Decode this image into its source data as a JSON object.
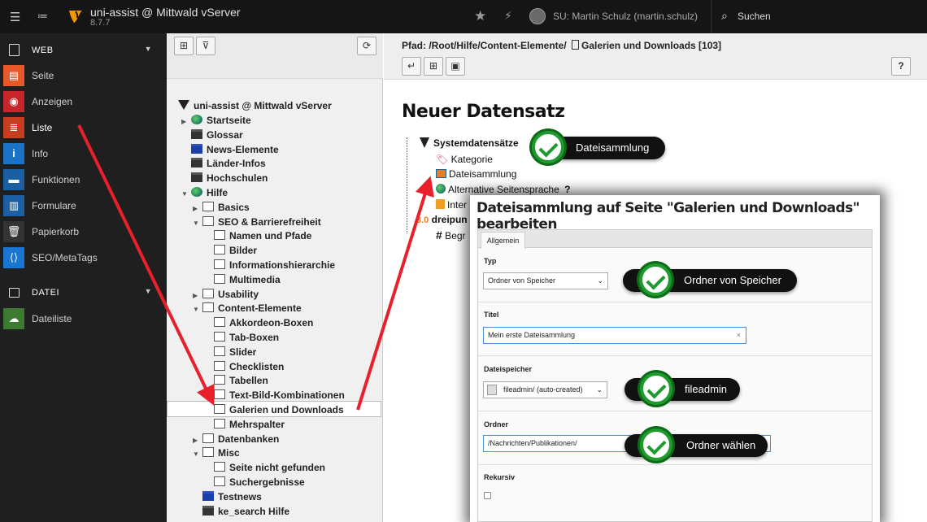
{
  "topbar": {
    "site_title": "uni-assist @ Mittwald vServer",
    "version": "8.7.7",
    "user": "SU: Martin Schulz (martin.schulz)",
    "search_label": "Suchen"
  },
  "sidebar": {
    "groups": [
      {
        "label": "WEB"
      },
      {
        "label": "DATEI"
      }
    ],
    "web_items": [
      {
        "label": "Seite",
        "color": "#e8582a"
      },
      {
        "label": "Anzeigen",
        "color": "#c6262b"
      },
      {
        "label": "Liste",
        "color": "#c43e1f"
      },
      {
        "label": "Info",
        "color": "#1a73c6"
      },
      {
        "label": "Funktionen",
        "color": "#1a5fa2"
      },
      {
        "label": "Formulare",
        "color": "#1d5fa3"
      },
      {
        "label": "Papierkorb",
        "color": "#333333"
      },
      {
        "label": "SEO/MetaTags",
        "color": "#1976d2"
      }
    ],
    "datei_items": [
      {
        "label": "Dateiliste",
        "color": "#3b7a2f"
      }
    ]
  },
  "tree": {
    "root": "uni-assist @ Mittwald vServer",
    "nodes": [
      "Startseite",
      "Glossar",
      "News-Elemente",
      "Länder-Infos",
      "Hochschulen",
      "Hilfe",
      "Basics",
      "SEO & Barrierefreiheit",
      "Namen und Pfade",
      "Bilder",
      "Informationshierarchie",
      "Multimedia",
      "Usability",
      "Content-Elemente",
      "Akkordeon-Boxen",
      "Tab-Boxen",
      "Slider",
      "Checklisten",
      "Tabellen",
      "Text-Bild-Kombinationen",
      "Galerien und Downloads",
      "Mehrspalter",
      "Datenbanken",
      "Misc",
      "Seite nicht gefunden",
      "Suchergebnisse",
      "Testnews",
      "ke_search Hilfe"
    ]
  },
  "doc": {
    "path_label": "Pfad: /Root/Hilfe/Content-Elemente/",
    "page_title": "Galerien und Downloads [103]",
    "help_label": "?",
    "heading": "Neuer Datensatz",
    "records": {
      "group": "Systemdatensätze",
      "items": [
        "Kategorie",
        "Dateisammlung",
        "Alternative Seitensprache",
        "Inter",
        "dreipun",
        "Begr"
      ],
      "question": "?"
    }
  },
  "dialog": {
    "title": "Dateisammlung auf Seite \"Galerien und Downloads\" bearbeiten",
    "tab": "Allgemein",
    "fields": {
      "typ_label": "Typ",
      "typ_value": "Ordner von Speicher",
      "titel_label": "Titel",
      "titel_value": "Mein erste Dateisammlung",
      "speicher_label": "Dateispeicher",
      "speicher_value": "fileadmin/ (auto-created)",
      "ordner_label": "Ordner",
      "ordner_value": "/Nachrichten/Publikationen/",
      "rekursiv_label": "Rekursiv"
    }
  },
  "callouts": [
    "Dateisammlung",
    "Ordner von Speicher",
    "fileadmin",
    "Ordner wählen"
  ]
}
